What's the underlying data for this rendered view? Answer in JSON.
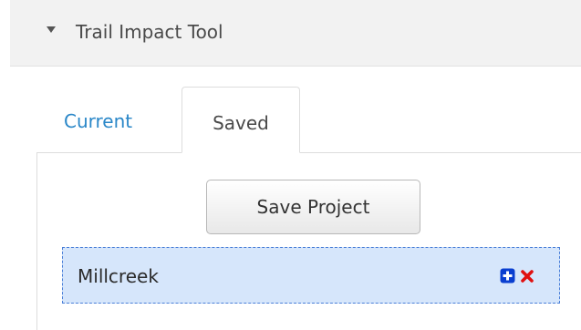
{
  "panel": {
    "title": "Trail Impact Tool"
  },
  "tabs": [
    {
      "label": "Current",
      "active": false
    },
    {
      "label": "Saved",
      "active": true
    }
  ],
  "saved": {
    "save_button_label": "Save Project",
    "projects": [
      {
        "name": "Millcreek",
        "icons": [
          "add-icon",
          "remove-icon"
        ]
      }
    ]
  },
  "colors": {
    "tab_link": "#2a87c8",
    "row_background": "#d6e6fb",
    "row_border": "#4a7fd8",
    "add_icon": "#0a3fd0",
    "remove_icon": "#e01010"
  }
}
